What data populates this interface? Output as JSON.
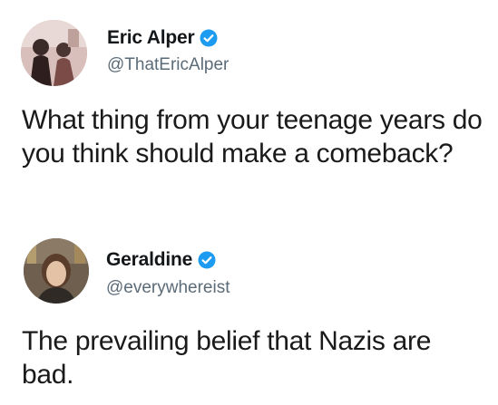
{
  "tweets": [
    {
      "author_name": "Eric Alper",
      "handle": "@ThatEricAlper",
      "verified": true,
      "text": "What thing from your teenage years do you think should make a comeback?",
      "avatar_icon": "profile-photo-people"
    },
    {
      "author_name": "Geraldine",
      "handle": "@everywhereist",
      "verified": true,
      "text": "The prevailing belief that Nazis are bad.",
      "avatar_icon": "profile-photo-woman"
    }
  ],
  "colors": {
    "verified_badge": "#1d9bf0",
    "handle_text": "#5b6b78",
    "name_text": "#14171a",
    "background": "#ffffff"
  }
}
